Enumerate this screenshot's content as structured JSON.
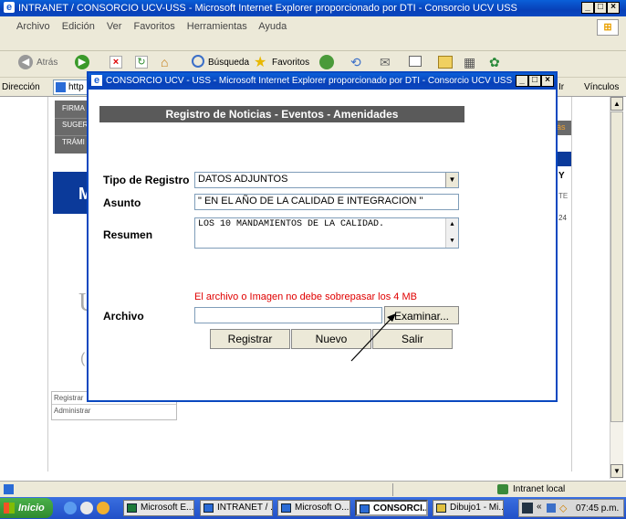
{
  "outer": {
    "title": "INTRANET / CONSORCIO UCV-USS - Microsoft Internet Explorer proporcionado por DTI - Consorcio UCV USS",
    "menu": [
      "Archivo",
      "Edición",
      "Ver",
      "Favoritos",
      "Herramientas",
      "Ayuda"
    ],
    "toolbar": {
      "back": "Atrás",
      "search": "Búsqueda",
      "favorites": "Favoritos"
    },
    "address_label": "Dirección",
    "address_value": "http",
    "go_label": "Ir",
    "links_label": "Vínculos",
    "status_zone": "Intranet local"
  },
  "bg_page": {
    "side_menu": [
      "FIRMA",
      "SUGER",
      "TRÁMI"
    ],
    "right_fragment": [
      "ás",
      "Y",
      "TE",
      "24"
    ],
    "bottom_links": [
      "Registrar",
      "Administrar"
    ]
  },
  "popup": {
    "title": "CONSORCIO UCV - USS - Microsoft Internet Explorer proporcionado por DTI - Consorcio UCV USS",
    "header": "Registro de Noticias - Eventos - Amenidades",
    "tipo_label": "Tipo de Registro",
    "tipo_value": "DATOS ADJUNTOS",
    "asunto_label": "Asunto",
    "asunto_value": "\" EN EL AÑO DE LA CALIDAD E INTEGRACION \"",
    "resumen_label": "Resumen",
    "resumen_value": "LOS 10 MANDAMIENTOS DE LA CALIDAD.",
    "warning": "El archivo o Imagen no debe sobrepasar los 4 MB",
    "archivo_label": "Archivo",
    "archivo_value": "",
    "examinar": "Examinar...",
    "registrar": "Registrar",
    "nuevo": "Nuevo",
    "salir": "Salir"
  },
  "taskbar": {
    "start": "Inicio",
    "items": [
      "Microsoft E...",
      "INTRANET / ...",
      "Microsoft O...",
      "CONSORCI...",
      "Dibujo1 - Mi..."
    ],
    "clock": "07:45 p.m."
  },
  "colors": {
    "xp_blue": "#0a48c0",
    "header_gray": "#5a5a5a",
    "warning_red": "#e00000",
    "banner_blue": "#0b3a9a"
  }
}
